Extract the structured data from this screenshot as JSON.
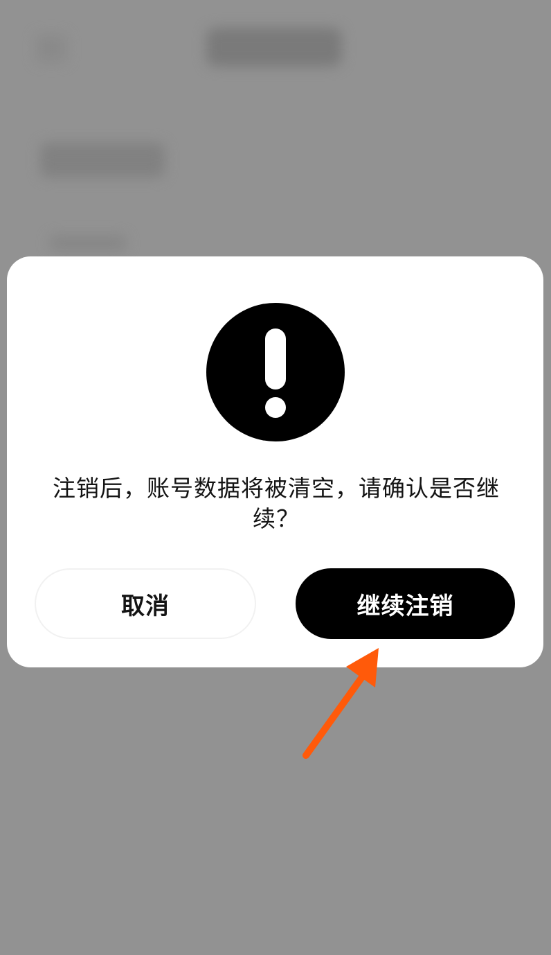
{
  "background_page": {
    "blurred": true
  },
  "dialog": {
    "icon": "exclamation-circle-icon",
    "message": "注销后，账号数据将被清空，请确认是否继续？",
    "cancel_label": "取消",
    "confirm_label": "继续注销"
  },
  "annotation": {
    "icon": "arrow-up-right-icon",
    "color": "#ff5a0a"
  },
  "colors": {
    "overlay": "#929292",
    "dialog_bg": "#ffffff",
    "confirm_bg": "#000000",
    "confirm_text": "#ffffff",
    "text": "#141414"
  }
}
